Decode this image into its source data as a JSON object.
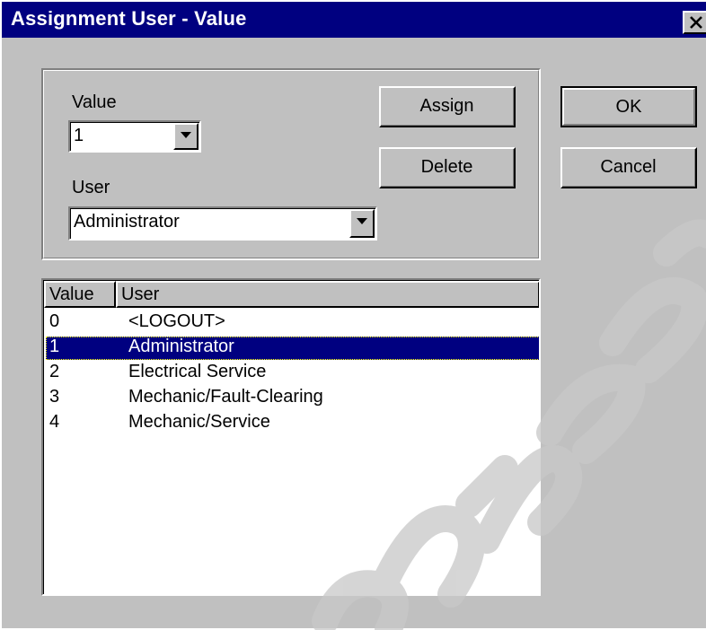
{
  "window": {
    "title": "Assignment User - Value",
    "close_symbol": "×"
  },
  "form": {
    "value_label": "Value",
    "value_selected": "1",
    "user_label": "User",
    "user_selected": "Administrator"
  },
  "buttons": {
    "assign": "Assign",
    "delete": "Delete",
    "ok": "OK",
    "cancel": "Cancel"
  },
  "list": {
    "columns": [
      "Value",
      "User"
    ],
    "rows": [
      {
        "value": "0",
        "user": "<LOGOUT>",
        "selected": false
      },
      {
        "value": "1",
        "user": "Administrator",
        "selected": true
      },
      {
        "value": "2",
        "user": "Electrical Service",
        "selected": false
      },
      {
        "value": "3",
        "user": "Mechanic/Fault-Clearing",
        "selected": false
      },
      {
        "value": "4",
        "user": "Mechanic/Service",
        "selected": false
      }
    ]
  },
  "colors": {
    "titlebar": "#000080",
    "face": "#c0c0c0",
    "selection": "#000080",
    "watermark": "#c8c8c8"
  },
  "icons": {
    "close": "close-icon",
    "dropdown": "chevron-down-icon"
  }
}
